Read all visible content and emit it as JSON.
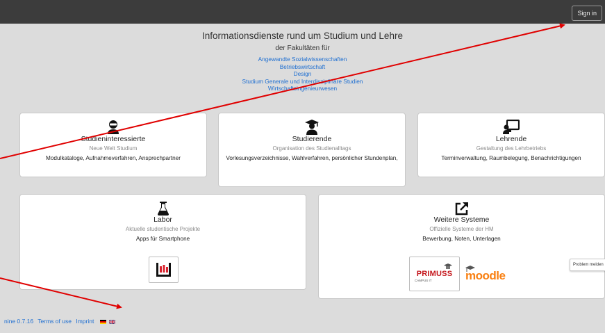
{
  "topbar": {
    "signin_label": "Sign in"
  },
  "header": {
    "title": "Informationsdienste rund um Studium und Lehre",
    "subtitle": "der Fakultäten für",
    "links": [
      "Angewandte Sozialwissenschaften",
      "Betriebswirtschaft",
      "Design",
      "Studium Generale und Interdisziplinäre Studien",
      "Wirtschaftsingenieurwesen"
    ]
  },
  "cards": {
    "studieninteressierte": {
      "title": "Studieninteressierte",
      "sub": "Neue Welt Studium",
      "desc": "Modulkataloge, Aufnahmeverfahren, Ansprechpartner"
    },
    "studierende": {
      "title": "Studierende",
      "sub": "Organisation des Studienalltags",
      "desc": "Vorlesungsverzeichnisse, Wahlverfahren, persönlicher Stundenplan,"
    },
    "lehrende": {
      "title": "Lehrende",
      "sub": "Gestaltung des Lehrbetriebs",
      "desc": "Terminverwaltung, Raumbelegung, Benachrichtigungen"
    },
    "labor": {
      "title": "Labor",
      "sub": "Aktuelle studentische Projekte",
      "desc": "Apps für Smartphone"
    },
    "weitere": {
      "title": "Weitere Systeme",
      "sub": "Offizielle Systeme der HM",
      "desc": "Bewerbung, Noten, Unterlagen"
    }
  },
  "logos": {
    "primuss_main": "PRIMUSS",
    "primuss_sub": "CAMPUS IT",
    "moodle": "moodle"
  },
  "problem_label": "Problem melden",
  "footer": {
    "version": "nine 0.7.16",
    "terms": "Terms of use",
    "imprint": "Imprint"
  },
  "colors": {
    "link": "#1f6fd1",
    "topbar": "#3c3c3c",
    "background": "#dcdcdc",
    "arrow": "#e00000"
  }
}
